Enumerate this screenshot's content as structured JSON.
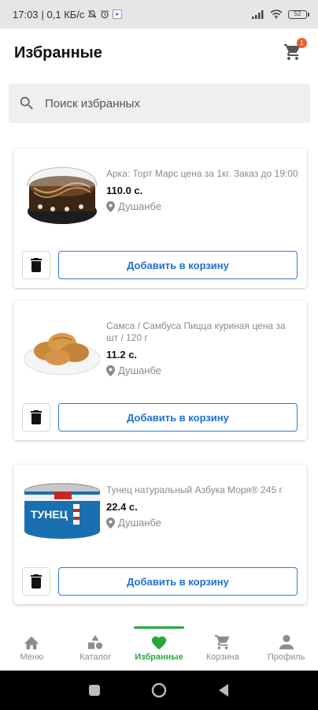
{
  "status_bar": {
    "time": "17:03",
    "network_speed": "| 0,1 КБ/с",
    "battery": "52"
  },
  "header": {
    "title": "Избранные",
    "cart_count": "1"
  },
  "search": {
    "placeholder": "Поиск избранных"
  },
  "products": [
    {
      "name": "Арка: Торт Марс цена за 1кг. Заказ до 19:00",
      "price": "110.0 с.",
      "location": "Душанбе",
      "add_label": "Добавить в корзину",
      "image": "cake"
    },
    {
      "name": "Самса / Самбуса Пицца куриная цена за шт / 120 г",
      "price": "11.2 с.",
      "location": "Душанбе",
      "add_label": "Добавить в корзину",
      "image": "samsa"
    },
    {
      "name": "Тунец натуральный Азбука Моря® 245 г",
      "price": "22.4 с.",
      "location": "Душанбе",
      "add_label": "Добавить в корзину",
      "image": "tuna-can",
      "image_text": "ТУНЕЦ"
    }
  ],
  "bottom_nav": [
    {
      "label": "Меню",
      "icon": "home-icon",
      "active": false
    },
    {
      "label": "Каталог",
      "icon": "catalog-icon",
      "active": false
    },
    {
      "label": "Избранные",
      "icon": "heart-icon",
      "active": true
    },
    {
      "label": "Корзина",
      "icon": "cart-icon",
      "active": false
    },
    {
      "label": "Профиль",
      "icon": "person-icon",
      "active": false
    }
  ],
  "colors": {
    "accent_green": "#25a93c",
    "button_blue": "#1e6fd6",
    "badge_orange": "#e95f2b"
  }
}
